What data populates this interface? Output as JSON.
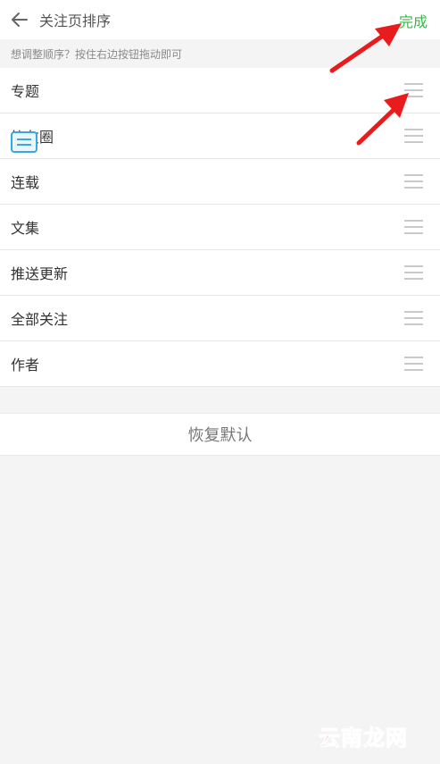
{
  "header": {
    "title": "关注页排序",
    "done_label": "完成",
    "back_icon": "arrow-left-icon"
  },
  "hint": "想调整顺序？按住右边按钮拖动即可",
  "list": {
    "items": [
      {
        "label": "专题"
      },
      {
        "label": "简友圈"
      },
      {
        "label": "连载"
      },
      {
        "label": "文集"
      },
      {
        "label": "推送更新"
      },
      {
        "label": "全部关注"
      },
      {
        "label": "作者"
      }
    ],
    "drag_icon": "drag-handle-icon"
  },
  "restore_label": "恢复默认",
  "watermark": "云南龙网",
  "colors": {
    "accent_green": "#3ab54a",
    "annotation_red": "#e81c1c",
    "watermark_orange": "#ff5a1f",
    "background": "#f4f4f4"
  }
}
